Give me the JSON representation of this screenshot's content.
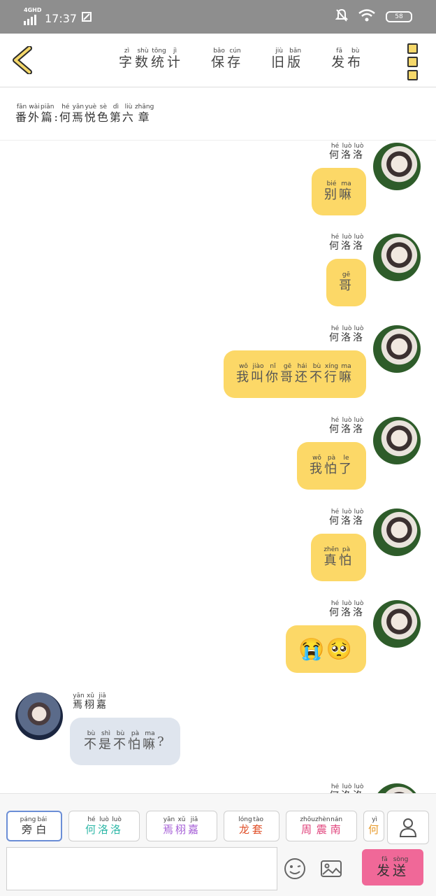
{
  "status_bar": {
    "network": "4GHD",
    "time": "17:37",
    "battery": "58"
  },
  "top_bar": {
    "items": [
      {
        "label": "字数统计",
        "pinyin": [
          "zì",
          "shù",
          "tǒng",
          "jì"
        ]
      },
      {
        "label": "保存",
        "pinyin": [
          "bǎo",
          "cún"
        ]
      },
      {
        "label": "旧版",
        "pinyin": [
          "jiù",
          "bǎn"
        ]
      },
      {
        "label": "发布",
        "pinyin": [
          "fā",
          "bù"
        ]
      }
    ]
  },
  "chapter_title": {
    "chars": [
      "番",
      "外",
      "篇",
      ":",
      "何",
      "焉",
      "悦",
      "色",
      "第",
      "六",
      "章"
    ],
    "pinyin": [
      "fān",
      "wài",
      "piān",
      "",
      "hé",
      "yān",
      "yuè",
      "sè",
      "dì",
      "liù",
      "zhāng"
    ]
  },
  "messages": [
    {
      "side": "right",
      "speaker": "何洛洛",
      "speaker_pinyin": [
        "hé",
        "luò",
        "luò"
      ],
      "chars": [
        "别",
        "嘛"
      ],
      "pinyin": [
        "bié",
        "ma"
      ]
    },
    {
      "side": "right",
      "speaker": "何洛洛",
      "speaker_pinyin": [
        "hé",
        "luò",
        "luò"
      ],
      "chars": [
        "哥"
      ],
      "pinyin": [
        "gē"
      ]
    },
    {
      "side": "right",
      "speaker": "何洛洛",
      "speaker_pinyin": [
        "hé",
        "luò",
        "luò"
      ],
      "chars": [
        "我",
        "叫",
        "你",
        "哥",
        "还",
        "不",
        "行",
        "嘛"
      ],
      "pinyin": [
        "wǒ",
        "jiào",
        "nǐ",
        "gē",
        "hái",
        "bù",
        "xíng",
        "ma"
      ]
    },
    {
      "side": "right",
      "speaker": "何洛洛",
      "speaker_pinyin": [
        "hé",
        "luò",
        "luò"
      ],
      "chars": [
        "我",
        "怕",
        "了"
      ],
      "pinyin": [
        "wǒ",
        "pà",
        "le"
      ]
    },
    {
      "side": "right",
      "speaker": "何洛洛",
      "speaker_pinyin": [
        "hé",
        "luò",
        "luò"
      ],
      "chars": [
        "真",
        "怕"
      ],
      "pinyin": [
        "zhēn",
        "pà"
      ]
    },
    {
      "side": "right",
      "speaker": "何洛洛",
      "speaker_pinyin": [
        "hé",
        "luò",
        "luò"
      ],
      "chars": [
        "😭",
        "🥺"
      ],
      "pinyin": [
        "",
        ""
      ]
    },
    {
      "side": "left",
      "speaker": "焉栩嘉",
      "speaker_pinyin": [
        "yān",
        "xǔ",
        "jiā"
      ],
      "chars": [
        "不",
        "是",
        "不",
        "怕",
        "嘛",
        "?"
      ],
      "pinyin": [
        "bù",
        "shì",
        "bù",
        "pà",
        "ma",
        ""
      ]
    },
    {
      "side": "right",
      "speaker": "何洛洛",
      "speaker_pinyin": [
        "hé",
        "luò",
        "luò"
      ],
      "chars": [],
      "pinyin": []
    }
  ],
  "role_chips": [
    {
      "label": "旁白",
      "pinyin": [
        "páng",
        "bái"
      ],
      "color": "#333333"
    },
    {
      "label": "何洛洛",
      "pinyin": [
        "hé",
        "luò",
        "luò"
      ],
      "color": "#2fb8a8"
    },
    {
      "label": "焉栩嘉",
      "pinyin": [
        "yān",
        "xǔ",
        "jiā"
      ],
      "color": "#a35bd6"
    },
    {
      "label": "龙套",
      "pinyin": [
        "lóng",
        "tào"
      ],
      "color": "#e0502a"
    },
    {
      "label": "周震南",
      "pinyin": [
        "zhōu",
        "zhèn",
        "nán"
      ],
      "color": "#e0407a"
    },
    {
      "label": "何",
      "pinyin": [
        "yì"
      ],
      "color": "#e89a2a"
    }
  ],
  "send_button": {
    "label": "发送",
    "pinyin": [
      "fā",
      "sòng"
    ]
  },
  "colors": {
    "bubble_right": "#fcd867",
    "bubble_left": "#dfe5ee",
    "send": "#f06898",
    "status_bar": "#8e8e8e"
  }
}
